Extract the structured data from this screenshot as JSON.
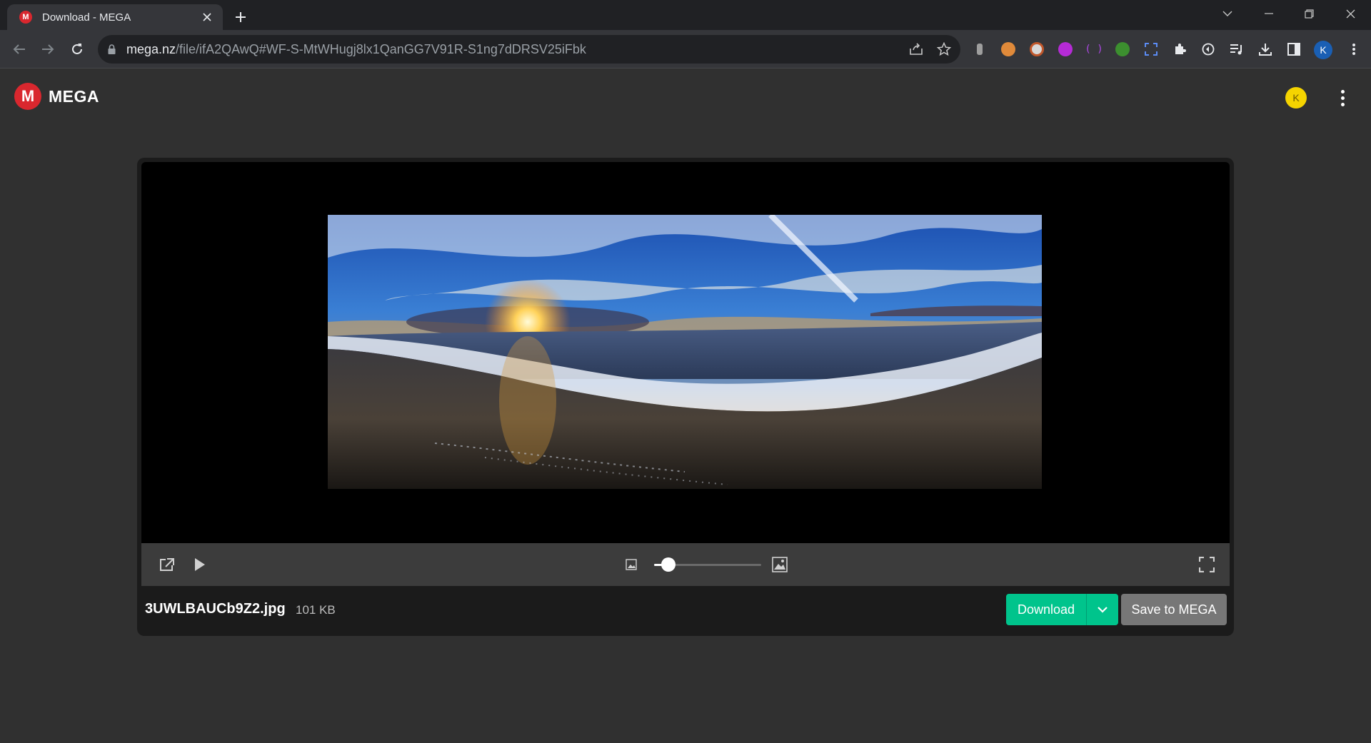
{
  "browser": {
    "tab_title": "Download - MEGA",
    "favicon_letter": "M",
    "url_host": "mega.nz",
    "url_path": "/file/ifA2QAwQ#WF-S-MtWHugj8lx1QanGG7V91R-S1ng7dDRSV25iFbk",
    "profile_initial": "K",
    "extension_icons": [
      "bottle-icon",
      "cookie-icon",
      "mask-icon",
      "grin-icon",
      "brackets-icon",
      "tree-icon",
      "color-picker-icon",
      "puzzle-icon",
      "refresh-icon",
      "media-list-icon",
      "download-icon",
      "sidebar-icon"
    ]
  },
  "header": {
    "logo_mark": "M",
    "logo_text": "MEGA",
    "avatar_initial": "K"
  },
  "viewer": {
    "zoom_level": 0.13
  },
  "file": {
    "name": "3UWLBAUCb9Z2.jpg",
    "size": "101 KB"
  },
  "actions": {
    "download_label": "Download",
    "save_label": "Save to MEGA"
  },
  "colors": {
    "accent_download": "#00c48c",
    "brand_red": "#d9272e",
    "avatar_yellow": "#f5d400"
  }
}
